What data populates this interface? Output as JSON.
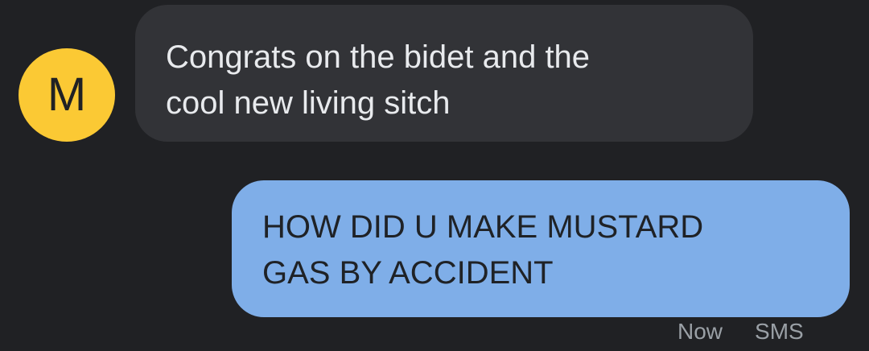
{
  "conversation": {
    "incoming": {
      "avatar_letter": "M",
      "text_lines": [
        "Congrats on the bidet and the",
        "cool new living sitch"
      ]
    },
    "outgoing": {
      "text_lines": [
        "HOW DID U MAKE MUSTARD",
        "GAS BY ACCIDENT"
      ],
      "status": "Now",
      "type": "SMS"
    }
  },
  "colors": {
    "background": "#202124",
    "incoming_bubble": "#323337",
    "outgoing_bubble": "#7faee8",
    "avatar": "#fbc934"
  }
}
